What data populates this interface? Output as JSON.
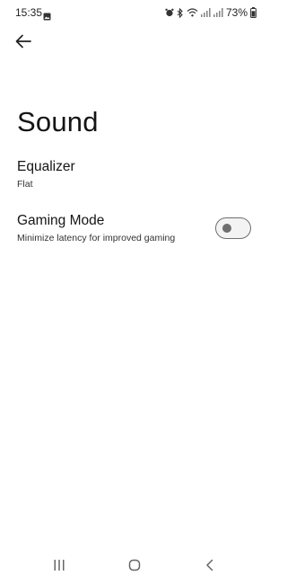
{
  "status_bar": {
    "time": "15:35",
    "battery": "73%",
    "icons": [
      "gallery-icon",
      "alarm-icon",
      "bluetooth-icon",
      "wifi-icon",
      "signal-icon",
      "signal-icon",
      "battery-icon"
    ]
  },
  "header": {
    "back_icon": "arrow-left-icon"
  },
  "page": {
    "title": "Sound"
  },
  "settings": {
    "equalizer": {
      "title": "Equalizer",
      "value": "Flat"
    },
    "gaming_mode": {
      "title": "Gaming Mode",
      "description": "Minimize latency for improved gaming",
      "enabled": false
    }
  },
  "nav_bar": {
    "icons": [
      "recents-icon",
      "home-icon",
      "back-icon"
    ]
  },
  "colors": {
    "background": "#ffffff",
    "text": "#151515",
    "toggle_off": "#6f6f6f"
  }
}
